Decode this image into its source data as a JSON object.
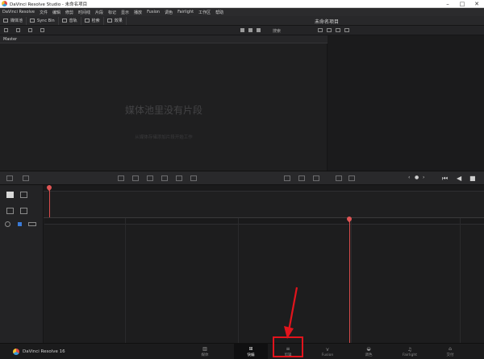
{
  "window": {
    "title": "DaVinci Resolve Studio - 未命名项目",
    "minimize_icon": "minimize-icon",
    "maximize_icon": "maximize-icon",
    "close_icon": "close-icon"
  },
  "menu": [
    "DaVinci Resolve",
    "文件",
    "编辑",
    "修剪",
    "时间线",
    "片段",
    "标记",
    "显示",
    "播放",
    "Fusion",
    "调色",
    "Fairlight",
    "工作区",
    "帮助"
  ],
  "toolbar": {
    "media_pool": "媒体池",
    "sync_bin": "Sync Bin",
    "audio": "音轨",
    "index": "检索",
    "effects": "效果",
    "project_title": "未命名项目"
  },
  "pool": {
    "sort_label": "搜索",
    "master_label": "Master",
    "empty_title": "媒体池里没有片段",
    "empty_hint": "从媒体存储添加片段开始工作"
  },
  "bottom": {
    "brand": "DaVinci Resolve 16",
    "pages": [
      {
        "icon": "▥",
        "label": "媒体"
      },
      {
        "icon": "⊞",
        "label": "快编"
      },
      {
        "icon": "≡",
        "label": "剪辑"
      },
      {
        "icon": "⋎",
        "label": "Fusion"
      },
      {
        "icon": "◒",
        "label": "调色"
      },
      {
        "icon": "♫",
        "label": "Fairlight"
      },
      {
        "icon": "⌂",
        "label": "交付"
      }
    ]
  },
  "colors": {
    "accent_red": "#e1141c",
    "playhead": "#d84b4b"
  }
}
